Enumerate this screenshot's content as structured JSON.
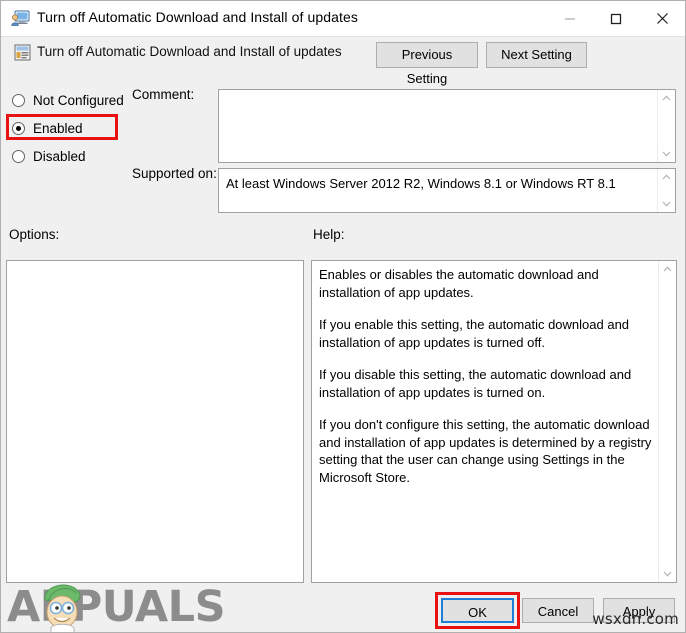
{
  "window": {
    "title": "Turn off Automatic Download and Install of updates",
    "icon": "monitor-user-icon",
    "controls": {
      "minimize": "minimize-icon",
      "maximize": "maximize-icon",
      "close": "close-icon"
    }
  },
  "header": {
    "icon": "policy-setting-icon",
    "title": "Turn off Automatic Download and Install of updates",
    "previous_button": "Previous Setting",
    "next_button": "Next Setting"
  },
  "state_options": [
    {
      "label": "Not Configured",
      "selected": false
    },
    {
      "label": "Enabled",
      "selected": true
    },
    {
      "label": "Disabled",
      "selected": false
    }
  ],
  "comment": {
    "label": "Comment:",
    "value": "",
    "scroll_up_icon": "chevron-up-icon",
    "scroll_down_icon": "chevron-down-icon"
  },
  "supported_on": {
    "label": "Supported on:",
    "value": "At least Windows Server 2012 R2, Windows 8.1 or Windows RT 8.1",
    "scroll_up_icon": "chevron-up-icon",
    "scroll_down_icon": "chevron-down-icon"
  },
  "options": {
    "label": "Options:",
    "content": ""
  },
  "help": {
    "label": "Help:",
    "paragraphs": [
      "Enables or disables the automatic download and installation of app updates.",
      "If you enable this setting, the automatic download and installation of app updates is turned off.",
      "If you disable this setting, the automatic download and installation of app updates is turned on.",
      "If you don't configure this setting, the automatic download and installation of app updates is determined by a registry setting that the user can change using Settings in the Microsoft Store."
    ]
  },
  "dialog_buttons": {
    "ok": "OK",
    "cancel": "Cancel",
    "apply": "Apply"
  },
  "watermarks": {
    "brand": "APPUALS",
    "site": "wsxdn.com"
  },
  "colors": {
    "highlight_red": "#e81212",
    "focus_blue": "#1f7fd4",
    "window_bg": "#f0f0f0",
    "button_bg": "#e1e1e1",
    "brand_gray": "#8c8c8c",
    "brand_green": "#6cb96c"
  }
}
